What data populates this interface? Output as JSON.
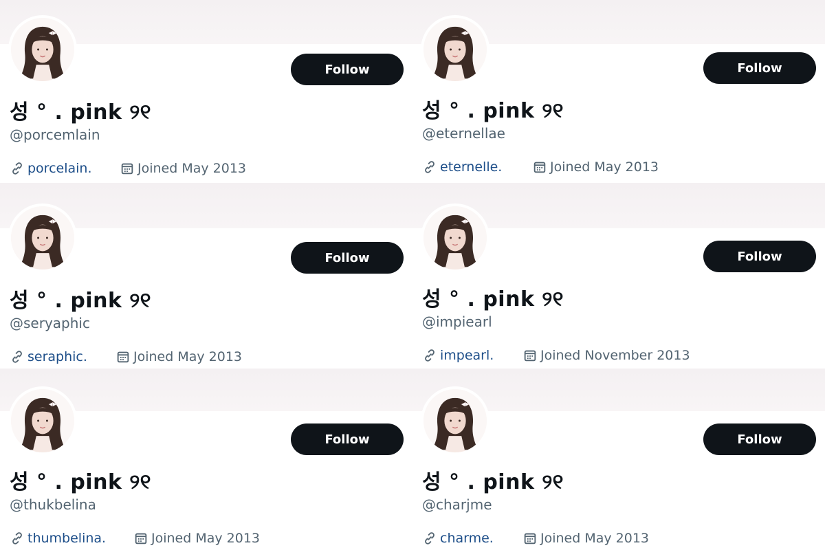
{
  "profiles": [
    {
      "name": "성 ° . pink ୨୧",
      "handle": "@porcemlain",
      "link": "porcelain.",
      "joined": "Joined May 2013",
      "follow_label": "Follow"
    },
    {
      "name": "성 ° . pink ୨୧",
      "handle": "@eternellae",
      "link": "eternelle.",
      "joined": "Joined May 2013",
      "follow_label": "Follow"
    },
    {
      "name": "성 ° . pink ୨୧",
      "handle": "@seryaphic",
      "link": "seraphic.",
      "joined": "Joined May 2013",
      "follow_label": "Follow"
    },
    {
      "name": "성 ° . pink ୨୧",
      "handle": "@impiearl",
      "link": "impearl.",
      "joined": "Joined November 2013",
      "follow_label": "Follow"
    },
    {
      "name": "성 ° . pink ୨୧",
      "handle": "@thukbelina",
      "link": "thumbelina.",
      "joined": "Joined May 2013",
      "follow_label": "Follow"
    },
    {
      "name": "성 ° . pink ୨୧",
      "handle": "@charjme",
      "link": "charme.",
      "joined": "Joined May 2013",
      "follow_label": "Follow"
    }
  ],
  "colors": {
    "follow_button": "#0f1419",
    "link": "#1d4e89",
    "secondary_text": "#536471",
    "banner": "#f4f0f2"
  },
  "icons": {
    "link": "link-icon",
    "joined": "calendar-icon"
  }
}
